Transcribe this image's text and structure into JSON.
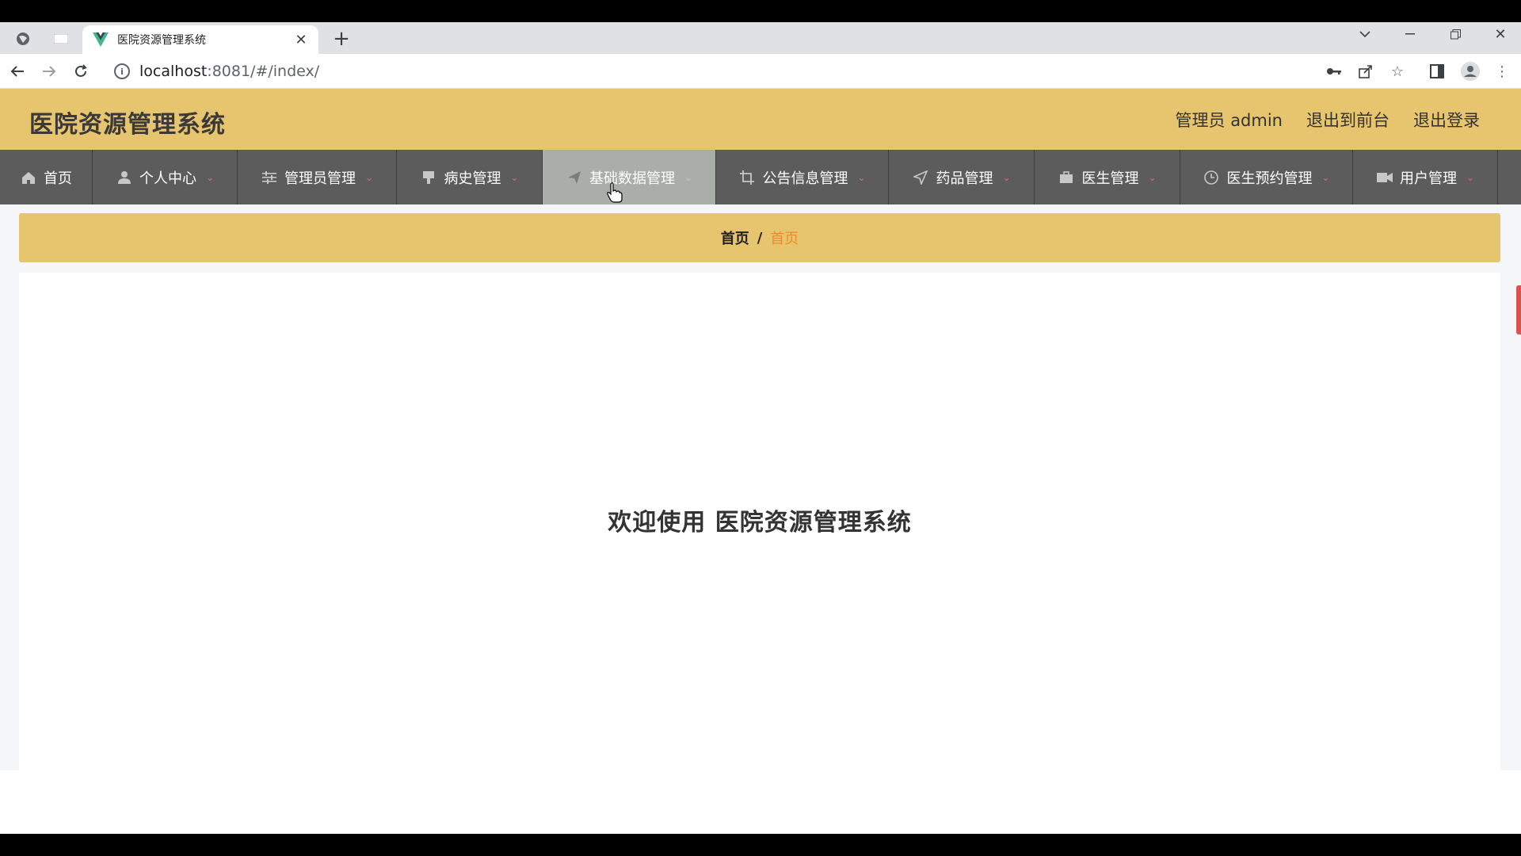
{
  "browser": {
    "tab_title": "医院资源管理系统",
    "url_host": "localhost",
    "url_rest": ":8081/#/index/"
  },
  "header": {
    "title": "医院资源管理系统",
    "user_label": "管理员 admin",
    "front_label": "退出到前台",
    "logout_label": "退出登录"
  },
  "menu": {
    "items": [
      {
        "label": "首页",
        "icon": "home-icon"
      },
      {
        "label": "个人中心",
        "icon": "user-icon"
      },
      {
        "label": "管理员管理",
        "icon": "sliders-icon"
      },
      {
        "label": "病史管理",
        "icon": "stamp-icon"
      },
      {
        "label": "基础数据管理",
        "icon": "send-icon"
      },
      {
        "label": "公告信息管理",
        "icon": "crop-icon"
      },
      {
        "label": "药品管理",
        "icon": "navigation-icon"
      },
      {
        "label": "医生管理",
        "icon": "briefcase-icon"
      },
      {
        "label": "医生预约管理",
        "icon": "clock-icon"
      },
      {
        "label": "用户管理",
        "icon": "video-icon"
      }
    ],
    "active_index": 4
  },
  "breadcrumb": {
    "home": "首页",
    "separator": "/",
    "current": "首页"
  },
  "main": {
    "welcome": "欢迎使用 医院资源管理系统"
  },
  "colors": {
    "accent": "#e7c46e",
    "menu_bg": "#5c5c5c",
    "menu_active": "#a9aea9",
    "breadcrumb_current": "#f08a2a"
  }
}
